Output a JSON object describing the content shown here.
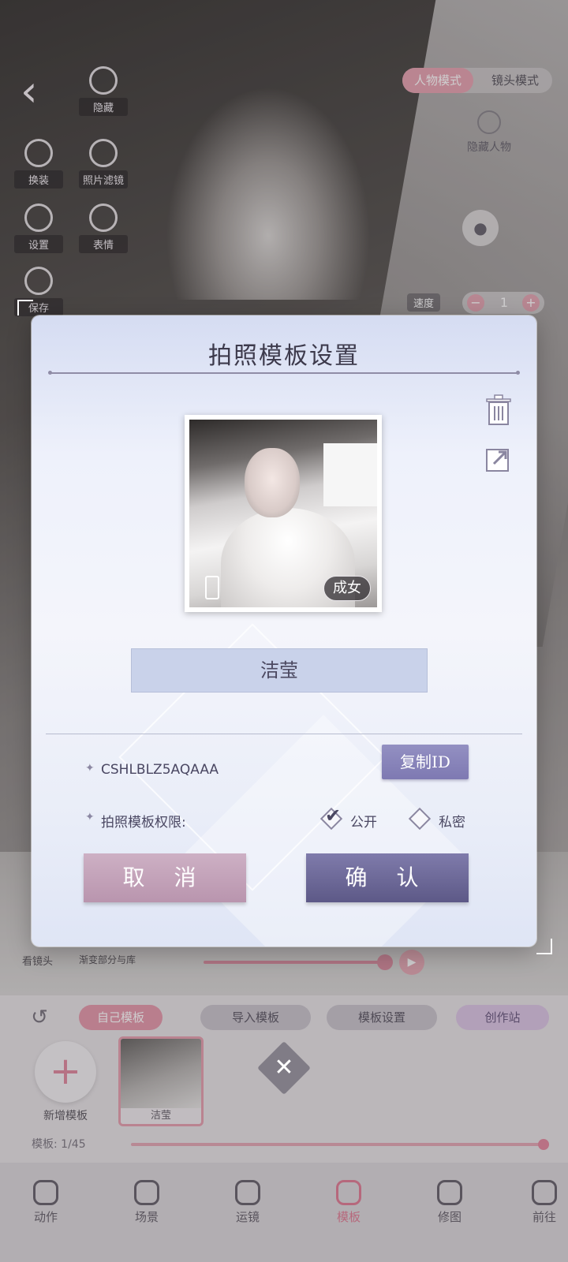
{
  "top_left_tools": [
    {
      "label": "隐藏",
      "icon": "settings-circle-icon"
    },
    {
      "label": "换装",
      "icon": "rotate-icon"
    },
    {
      "label": "照片滤镜",
      "icon": "camera-icon"
    },
    {
      "label": "设置",
      "icon": "group-icon"
    },
    {
      "label": "表情",
      "icon": "sparkle-icon"
    },
    {
      "label": "保存",
      "icon": "save-icon"
    }
  ],
  "modes": {
    "active": "人物模式",
    "other": "镜头模式"
  },
  "hide_person_label": "隐藏人物",
  "speed": {
    "label": "速度",
    "value": "1",
    "minus": "−",
    "plus": "+"
  },
  "timeline": {
    "label1": "看镜头",
    "label2": "渐变部分与库",
    "play_icon": "▶"
  },
  "dialog": {
    "title": "拍照模板设置",
    "photo_tag": "成女",
    "name_value": "洁莹",
    "template_id": "CSHLBLZ5AQAAA",
    "copy_label": "复制ID",
    "permission_label": "拍照模板权限:",
    "permission_options": [
      {
        "label": "公开",
        "checked": true
      },
      {
        "label": "私密",
        "checked": false
      }
    ],
    "cancel_label": "取 消",
    "confirm_label": "确 认",
    "star": "✦"
  },
  "bottom": {
    "undo_icon": "↺",
    "pills": {
      "my": "自己模板",
      "import": "导入模板",
      "settings": "模板设置",
      "create": "创作站"
    },
    "add_label": "新增模板",
    "add_icon": "+",
    "card_name": "洁莹",
    "close_icon": "✕",
    "count": "模板: 1/45"
  },
  "nav": [
    {
      "label": "动作",
      "active": false
    },
    {
      "label": "场景",
      "active": false
    },
    {
      "label": "运镜",
      "active": false
    },
    {
      "label": "模板",
      "active": true
    },
    {
      "label": "修图",
      "active": false
    },
    {
      "label": "前往",
      "active": false
    }
  ],
  "colors": {
    "accent_pink": "#e49aac",
    "confirm_purple": "#5d5987",
    "cancel_mauve": "#b995ae"
  }
}
